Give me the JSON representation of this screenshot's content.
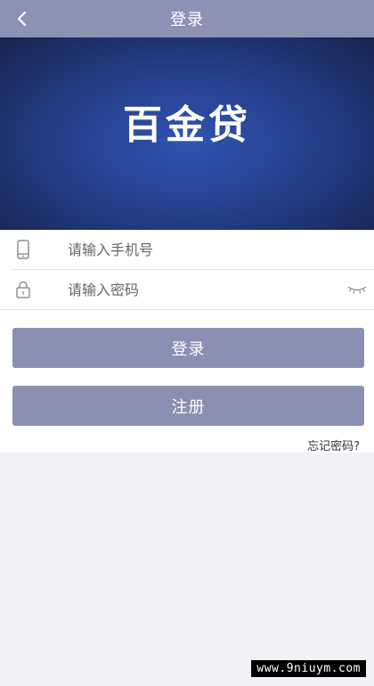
{
  "header": {
    "title": "登录",
    "back_icon": "chevron-left-icon"
  },
  "hero": {
    "brand": "百金贷"
  },
  "form": {
    "phone_placeholder": "请输入手机号",
    "password_placeholder": "请输入密码",
    "phone_icon": "phone-icon",
    "lock_icon": "lock-icon",
    "eye_icon": "eye-closed-icon"
  },
  "buttons": {
    "login": "登录",
    "register": "注册"
  },
  "links": {
    "forgot_password": "忘记密码?"
  },
  "watermark": "www.9niuym.com",
  "colors": {
    "accent": "#8c92b4",
    "hero_blue": "#2f54b2"
  }
}
